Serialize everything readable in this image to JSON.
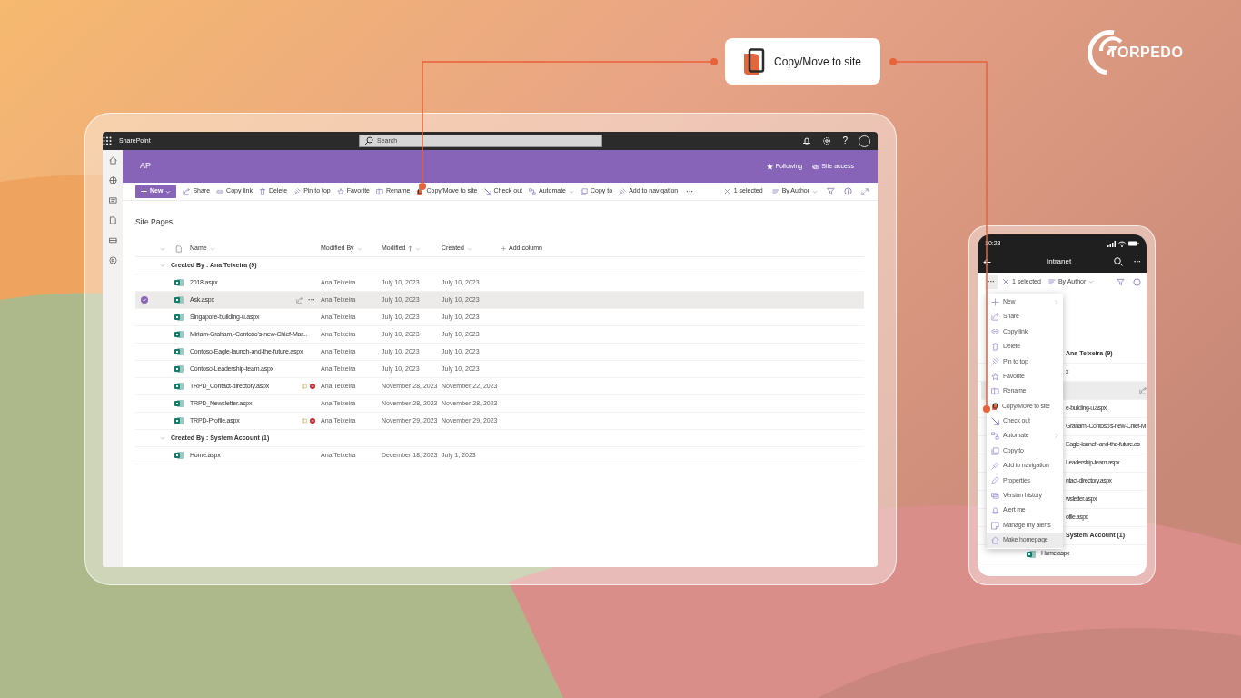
{
  "callout": {
    "label": "Copy/Move to site"
  },
  "logo": {
    "text": "TORPEDO"
  },
  "desktop": {
    "app_bar": {
      "app_name": "SharePoint",
      "search_placeholder": "Search",
      "help": "?"
    },
    "site": {
      "title": "AP",
      "following": "Following",
      "site_access": "Site access"
    },
    "commands": [
      {
        "label": "New",
        "kind": "primary",
        "has_menu": true
      },
      {
        "label": "Share",
        "kind": "command",
        "has_menu": false
      },
      {
        "label": "Copy link",
        "kind": "command",
        "has_menu": false
      },
      {
        "label": "Delete",
        "kind": "command",
        "has_menu": false
      },
      {
        "label": "Pin to top",
        "kind": "command",
        "has_menu": false
      },
      {
        "label": "Favorite",
        "kind": "command",
        "has_menu": false
      },
      {
        "label": "Rename",
        "kind": "command",
        "has_menu": false
      },
      {
        "label": "Copy/Move to site",
        "kind": "command",
        "has_menu": false
      },
      {
        "label": "Check out",
        "kind": "command",
        "has_menu": false
      },
      {
        "label": "Automate",
        "kind": "command",
        "has_menu": true
      },
      {
        "label": "Copy to",
        "kind": "command",
        "has_menu": false
      },
      {
        "label": "Add to navigation",
        "kind": "command",
        "has_menu": false
      },
      {
        "label": "···",
        "kind": "overflow",
        "has_menu": false
      }
    ],
    "selection": "1 selected",
    "group_by": "By Author",
    "library_title": "Site Pages",
    "columns": [
      {
        "label": "Name",
        "sorted": false
      },
      {
        "label": "Modified By",
        "sorted": false
      },
      {
        "label": "Modified",
        "sorted": true
      },
      {
        "label": "Created",
        "sorted": false
      }
    ],
    "add_column": "Add column",
    "groups": [
      {
        "title": "Created By : Ana Teixeira (9)",
        "expanded": true,
        "rows": [
          {
            "name": "2018.aspx",
            "modified_by": "Ana Teixeira",
            "modified": "July 10, 2023",
            "created": "July 10, 2023",
            "selected": false,
            "checked_out": false
          },
          {
            "name": "Ask.aspx",
            "modified_by": "Ana Teixeira",
            "modified": "July 10, 2023",
            "created": "July 10, 2023",
            "selected": true,
            "checked_out": false
          },
          {
            "name": "Singapore-building-u.aspx",
            "modified_by": "Ana Teixeira",
            "modified": "July 10, 2023",
            "created": "July 10, 2023",
            "selected": false,
            "checked_out": false
          },
          {
            "name": "Miriam-Graham,-Contoso's-new-Chief-Mar...",
            "modified_by": "Ana Teixeira",
            "modified": "July 10, 2023",
            "created": "July 10, 2023",
            "selected": false,
            "checked_out": false
          },
          {
            "name": "Contoso-Eagle-launch-and-the-future.aspx",
            "modified_by": "Ana Teixeira",
            "modified": "July 10, 2023",
            "created": "July 10, 2023",
            "selected": false,
            "checked_out": false
          },
          {
            "name": "Contoso-Leadership-team.aspx",
            "modified_by": "Ana Teixeira",
            "modified": "July 10, 2023",
            "created": "July 10, 2023",
            "selected": false,
            "checked_out": false
          },
          {
            "name": "TRPD_Contact-directory.aspx",
            "modified_by": "Ana Teixeira",
            "modified": "November 28, 2023",
            "created": "November 22, 2023",
            "selected": false,
            "checked_out": true
          },
          {
            "name": "TRPD_Newsletter.aspx",
            "modified_by": "Ana Teixeira",
            "modified": "November 28, 2023",
            "created": "November 28, 2023",
            "selected": false,
            "checked_out": false
          },
          {
            "name": "TRPD-Profile.aspx",
            "modified_by": "Ana Teixeira",
            "modified": "November 29, 2023",
            "created": "November 29, 2023",
            "selected": false,
            "checked_out": true
          }
        ]
      },
      {
        "title": "Created By : System Account (1)",
        "expanded": true,
        "rows": [
          {
            "name": "Home.aspx",
            "modified_by": "Ana Teixeira",
            "modified": "December 18, 2023",
            "created": "July 1, 2023",
            "selected": false,
            "checked_out": false
          }
        ]
      }
    ]
  },
  "phone": {
    "time": "10:28",
    "title": "Intranet",
    "more": "···",
    "overflow": "···",
    "selection": "1 selected",
    "group_by": "By Author",
    "menu": [
      {
        "label": "New",
        "submenu": true,
        "highlighted": false
      },
      {
        "label": "Share",
        "submenu": false,
        "highlighted": false
      },
      {
        "label": "Copy link",
        "submenu": false,
        "highlighted": false
      },
      {
        "label": "Delete",
        "submenu": false,
        "highlighted": false
      },
      {
        "label": "Pin to top",
        "submenu": false,
        "highlighted": false
      },
      {
        "label": "Favorite",
        "submenu": false,
        "highlighted": false
      },
      {
        "label": "Rename",
        "submenu": false,
        "highlighted": false
      },
      {
        "label": "Copy/Move to site",
        "submenu": false,
        "highlighted": false
      },
      {
        "label": "Check out",
        "submenu": false,
        "highlighted": false
      },
      {
        "label": "Automate",
        "submenu": true,
        "highlighted": false
      },
      {
        "label": "Copy to",
        "submenu": false,
        "highlighted": false
      },
      {
        "label": "Add to navigation",
        "submenu": false,
        "highlighted": false
      },
      {
        "label": "Properties",
        "submenu": false,
        "highlighted": false
      },
      {
        "label": "Version history",
        "submenu": false,
        "highlighted": false
      },
      {
        "label": "Alert me",
        "submenu": false,
        "highlighted": false
      },
      {
        "label": "Manage my alerts",
        "submenu": false,
        "highlighted": false
      },
      {
        "label": "Make homepage",
        "submenu": false,
        "highlighted": true
      }
    ],
    "list": [
      {
        "text": "Ana Teixeira (9)",
        "kind": "group",
        "selected": false
      },
      {
        "text": "x",
        "kind": "file",
        "selected": false
      },
      {
        "kind": "file",
        "selected": true
      },
      {
        "text": "e-building-u.aspx",
        "kind": "file",
        "selected": false
      },
      {
        "text": "Graham,-Contoso's-new-Chief-M",
        "kind": "file",
        "selected": false
      },
      {
        "text": "Eagle-launch-and-the-future.as",
        "kind": "file",
        "selected": false
      },
      {
        "text": "Leadership-team.aspx",
        "kind": "file",
        "selected": false
      },
      {
        "text": "ntact-directory.aspx",
        "kind": "file",
        "selected": false
      },
      {
        "text": "wsletter.aspx",
        "kind": "file",
        "selected": false
      },
      {
        "text": "ofile.aspx",
        "kind": "file",
        "selected": false
      },
      {
        "text": "System Account (1)",
        "kind": "group",
        "selected": false
      },
      {
        "text": "Home.aspx",
        "kind": "file",
        "selected": false
      }
    ]
  }
}
